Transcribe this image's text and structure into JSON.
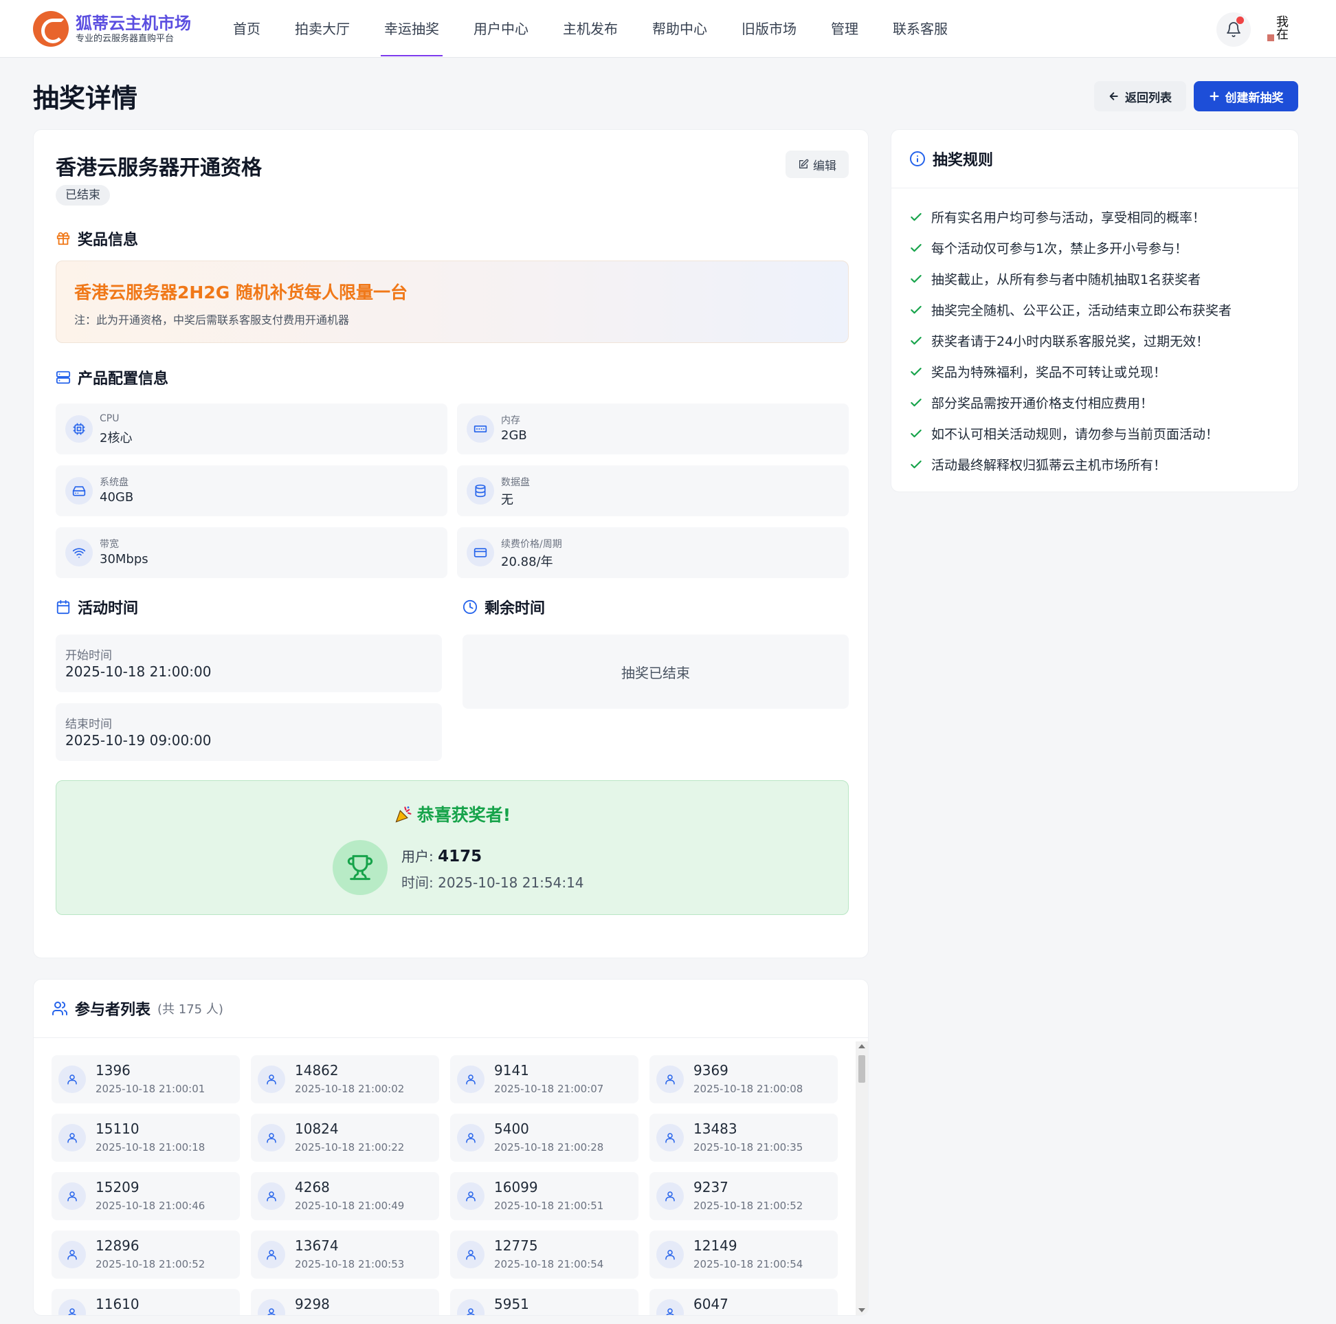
{
  "brand": {
    "name": "狐蒂云主机市场",
    "tagline": "专业的云服务器直购平台"
  },
  "nav": {
    "items": [
      {
        "label": "首页"
      },
      {
        "label": "拍卖大厅"
      },
      {
        "label": "幸运抽奖",
        "active": true
      },
      {
        "label": "用户中心"
      },
      {
        "label": "主机发布"
      },
      {
        "label": "帮助中心"
      },
      {
        "label": "旧版市场"
      },
      {
        "label": "管理"
      },
      {
        "label": "联系客服"
      }
    ],
    "avatar_text": "我在"
  },
  "page": {
    "title": "抽奖详情",
    "back_label": "返回列表",
    "create_label": "创建新抽奖"
  },
  "lottery": {
    "title": "香港云服务器开通资格",
    "status": "已结束",
    "edit_label": "编辑",
    "prize_heading": "奖品信息",
    "prize_name": "香港云服务器2H2G 随机补货每人限量一台",
    "prize_note": "注：此为开通资格，中奖后需联系客服支付费用开通机器",
    "config_heading": "产品配置信息",
    "specs": [
      {
        "label": "CPU",
        "value": "2核心",
        "icon": "cpu-icon"
      },
      {
        "label": "内存",
        "value": "2GB",
        "icon": "memory-icon"
      },
      {
        "label": "系统盘",
        "value": "40GB",
        "icon": "disk-icon"
      },
      {
        "label": "数据盘",
        "value": "无",
        "icon": "database-icon"
      },
      {
        "label": "带宽",
        "value": "30Mbps",
        "icon": "wifi-icon"
      },
      {
        "label": "续费价格/周期",
        "value": "20.88/年",
        "icon": "card-icon"
      }
    ],
    "time_heading": "活动时间",
    "start_label": "开始时间",
    "start_time": "2025-10-18 21:00:00",
    "end_label": "结束时间",
    "end_time": "2025-10-19 09:00:00",
    "remain_heading": "剩余时间",
    "remain_text": "抽奖已结束",
    "winner": {
      "title": "恭喜获奖者!",
      "user_label": "用户:",
      "user_id": "4175",
      "time_label": "时间:",
      "time": "2025-10-18 21:54:14"
    }
  },
  "rules": {
    "heading": "抽奖规则",
    "items": [
      "所有实名用户均可参与活动，享受相同的概率！",
      "每个活动仅可参与1次，禁止多开小号参与！",
      "抽奖截止，从所有参与者中随机抽取1名获奖者",
      "抽奖完全随机、公平公正，活动结束立即公布获奖者",
      "获奖者请于24小时内联系客服兑奖，过期无效！",
      "奖品为特殊福利，奖品不可转让或兑现！",
      "部分奖品需按开通价格支付相应费用！",
      "如不认可相关活动规则，请勿参与当前页面活动！",
      "活动最终解释权归狐蒂云主机市场所有！"
    ]
  },
  "participants": {
    "heading": "参与者列表",
    "count_text": "(共 175 人)",
    "items": [
      {
        "id": "1396",
        "time": "2025-10-18 21:00:01"
      },
      {
        "id": "14862",
        "time": "2025-10-18 21:00:02"
      },
      {
        "id": "9141",
        "time": "2025-10-18 21:00:07"
      },
      {
        "id": "9369",
        "time": "2025-10-18 21:00:08"
      },
      {
        "id": "15110",
        "time": "2025-10-18 21:00:18"
      },
      {
        "id": "10824",
        "time": "2025-10-18 21:00:22"
      },
      {
        "id": "5400",
        "time": "2025-10-18 21:00:28"
      },
      {
        "id": "13483",
        "time": "2025-10-18 21:00:35"
      },
      {
        "id": "15209",
        "time": "2025-10-18 21:00:46"
      },
      {
        "id": "4268",
        "time": "2025-10-18 21:00:49"
      },
      {
        "id": "16099",
        "time": "2025-10-18 21:00:51"
      },
      {
        "id": "9237",
        "time": "2025-10-18 21:00:52"
      },
      {
        "id": "12896",
        "time": "2025-10-18 21:00:52"
      },
      {
        "id": "13674",
        "time": "2025-10-18 21:00:53"
      },
      {
        "id": "12775",
        "time": "2025-10-18 21:00:54"
      },
      {
        "id": "12149",
        "time": "2025-10-18 21:00:54"
      },
      {
        "id": "11610",
        "time": ""
      },
      {
        "id": "9298",
        "time": ""
      },
      {
        "id": "5951",
        "time": ""
      },
      {
        "id": "6047",
        "time": ""
      }
    ]
  },
  "colors": {
    "accent": "#1d4ed8",
    "prize": "#f07818",
    "success": "#16a34a",
    "nav_active": "#7c3aed"
  }
}
